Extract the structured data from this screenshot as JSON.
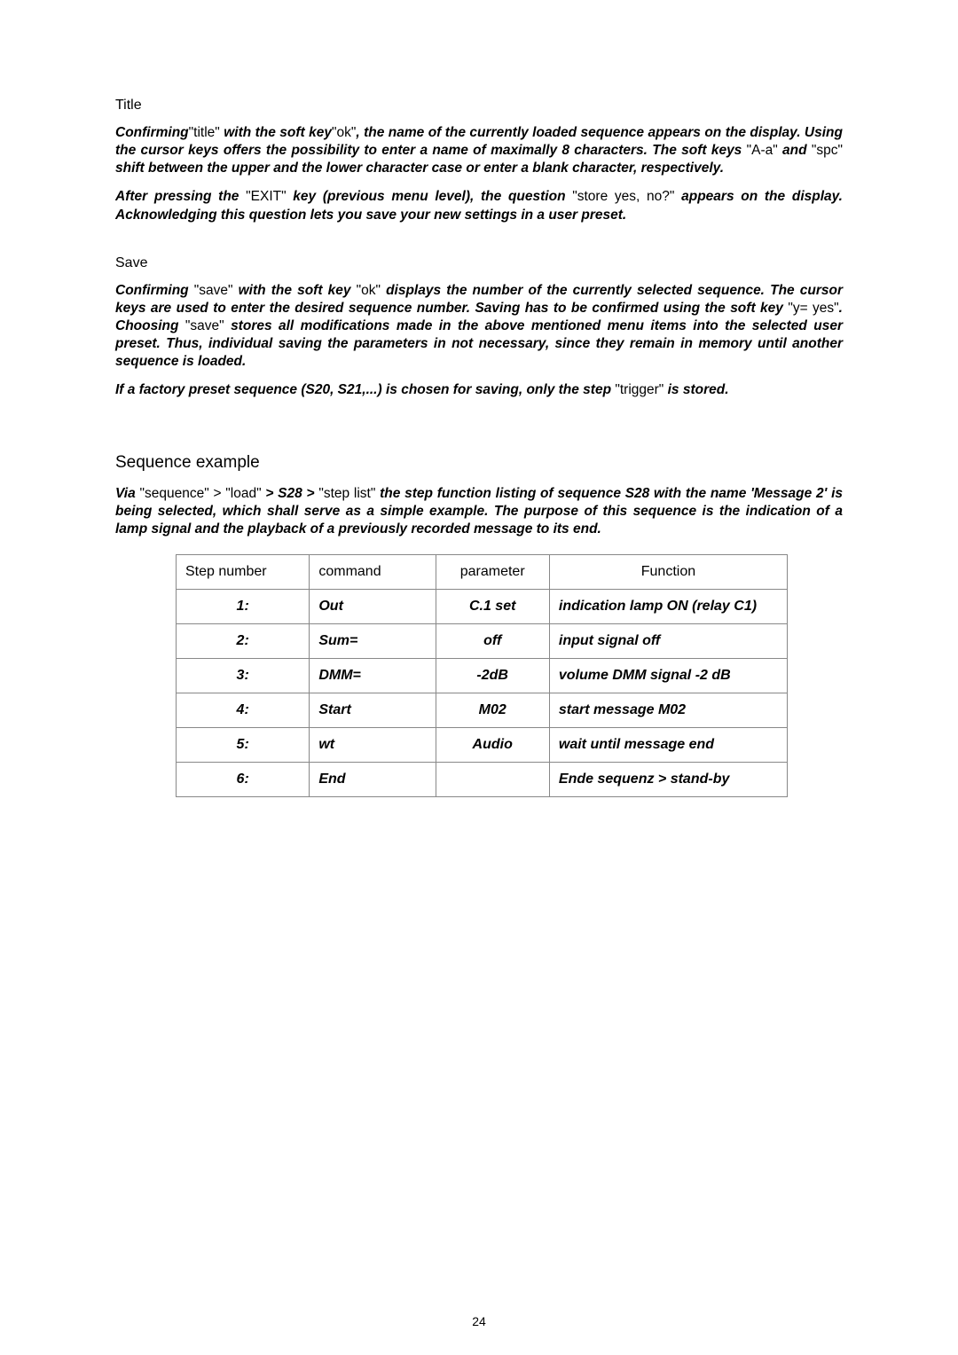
{
  "title_section": {
    "heading": "Title",
    "p1": {
      "t1": "Confirming",
      "t2": "\"title\"",
      "t3": " with the soft key",
      "t4": "\"ok\"",
      "t5": ", the name of the currently loaded sequence appears on the display. Using the cursor keys offers the possibility to enter a name of maximally 8 characters.",
      "t6": "The soft keys",
      "t7": " \"A-a\" ",
      "t8": "and",
      "t9": " \"spc\" ",
      "t10": "shift between the upper and the lower character case or enter a blank character, respectively."
    },
    "p2": {
      "t1": "After pressing the",
      "t2": " \"EXIT\" ",
      "t3": "key (previous menu level), the question",
      "t4": " \"store yes, no?\" ",
      "t5": "appears on the display. Acknowledging this question lets you save your new settings in a user preset."
    }
  },
  "save_section": {
    "heading": "Save",
    "p1": {
      "t1": "Confirming",
      "t2": " \"save\" ",
      "t3": "with the soft key",
      "t4": " \"ok\" ",
      "t5": "displays the number of the currently selected sequence. The cursor keys are used to enter the desired sequence number. Saving has to be confirmed using",
      "t6": " the soft key",
      "t7": " \"y= yes\"",
      "t8": ". Choosing",
      "t9": " \"save\" ",
      "t10": "stores all modifications made in the above mentioned menu items into the selected user preset. Thus, individual saving the parameters in not necessary, since",
      "t11": " they ",
      "t12": "remain in memory until another sequence is loaded."
    },
    "p2": {
      "t1": "If a factory preset sequence (S20, S21,...) is chosen for saving, only the",
      "t2": " step ",
      "t3": "\"trigger\"",
      "t4": " is stored."
    }
  },
  "sequence_section": {
    "heading": "Sequence example",
    "p1": {
      "t1": "Via ",
      "t2": "\"sequence\" > \"load\"",
      "t3": " > S28 > ",
      "t4": "\"step list\"",
      "t5": " the step function listing of sequence S28 with the name 'Message 2' is being selected, which shall serve as a simple example. The purpose of",
      "t6": " this sequence ",
      "t7": "is the indication of a lamp signal and the playback of a previously recorded message",
      "t8": " to its end."
    }
  },
  "table": {
    "headers": {
      "c1": "Step number",
      "c2": "command",
      "c3": "parameter",
      "c4": "Function"
    },
    "rows": [
      {
        "step": "1:",
        "cmd": "Out",
        "param": "C.1 set",
        "func": "indication lamp ON (relay C1)"
      },
      {
        "step": "2:",
        "cmd": "Sum=",
        "param": "off",
        "func": "input signal off"
      },
      {
        "step": "3:",
        "cmd": "DMM=",
        "param": "-2dB",
        "func": "volume DMM signal -2 dB"
      },
      {
        "step": "4:",
        "cmd": "Start",
        "param": "M02",
        "func": "start message M02"
      },
      {
        "step": "5:",
        "cmd": "wt",
        "param": "Audio",
        "func": "wait until message end"
      },
      {
        "step": "6:",
        "cmd": "End",
        "param": "",
        "func": "Ende sequenz > stand-by"
      }
    ]
  },
  "page_number": "24"
}
